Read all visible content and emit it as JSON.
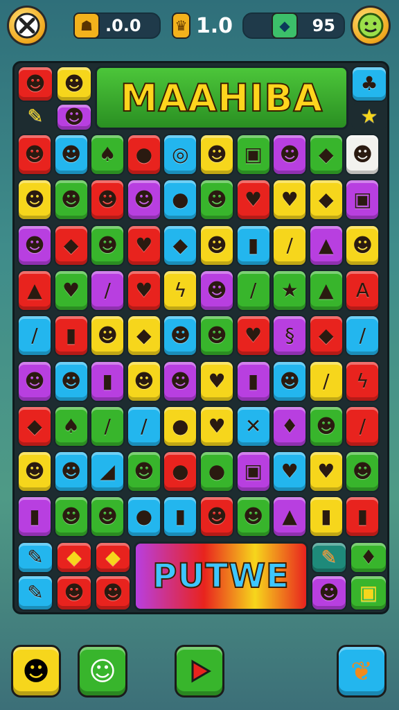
{
  "top_bar": {
    "close_icon": "close-icon",
    "coins": {
      "icon": "coin-icon",
      "value": ".0.0"
    },
    "trophy": {
      "icon": "trophy-icon",
      "value": "1.0"
    },
    "gems": {
      "icon": "gem-icon",
      "value": "95"
    },
    "profile_icon": "profile-avatar-icon"
  },
  "board": {
    "top_banner": "MAAHIBA",
    "bottom_banner": "PUTWE",
    "colors": {
      "R": "#e8231e",
      "Y": "#f6d61c",
      "G": "#38b52c",
      "B": "#23b6ee",
      "P": "#b83fe0",
      "O": "#f08a1c",
      "W": "#f2f2ee",
      "T": "#1e8a7a"
    },
    "rows": [
      [
        "R",
        "B",
        "G",
        "R",
        "B",
        "Y",
        "G",
        "P",
        "G",
        "W"
      ],
      [
        "Y",
        "G",
        "R",
        "P",
        "B",
        "G",
        "R",
        "Y",
        "Y",
        "P"
      ],
      [
        "P",
        "R",
        "G",
        "R",
        "B",
        "Y",
        "B",
        "Y",
        "P",
        "Y"
      ],
      [
        "R",
        "G",
        "P",
        "R",
        "Y",
        "P",
        "G",
        "G",
        "G",
        "R"
      ],
      [
        "B",
        "R",
        "Y",
        "Y",
        "B",
        "G",
        "R",
        "P",
        "R",
        "B"
      ],
      [
        "P",
        "B",
        "P",
        "Y",
        "P",
        "Y",
        "P",
        "B",
        "Y",
        "R"
      ],
      [
        "R",
        "G",
        "G",
        "B",
        "Y",
        "Y",
        "B",
        "P",
        "G",
        "R"
      ],
      [
        "Y",
        "B",
        "B",
        "G",
        "R",
        "G",
        "P",
        "B",
        "Y",
        "G"
      ],
      [
        "P",
        "G",
        "G",
        "B",
        "B",
        "R",
        "G",
        "P",
        "Y",
        "R"
      ]
    ],
    "glyphs": [
      [
        "☻",
        "☻",
        "♠",
        "●",
        "◎",
        "☻",
        "▣",
        "☻",
        "◆",
        "☻"
      ],
      [
        "☻",
        "☻",
        "☻",
        "☻",
        "●",
        "☻",
        "♥",
        "♥",
        "◆",
        "▣"
      ],
      [
        "☻",
        "◆",
        "☻",
        "♥",
        "◆",
        "☻",
        "▮",
        "/",
        "▲",
        "☻"
      ],
      [
        "▲",
        "♥",
        "/",
        "♥",
        "ϟ",
        "☻",
        "/",
        "★",
        "▲",
        "A"
      ],
      [
        "/",
        "▮",
        "☻",
        "◆",
        "☻",
        "☻",
        "♥",
        "§",
        "◆",
        "/"
      ],
      [
        "☻",
        "☻",
        "▮",
        "☻",
        "☻",
        "♥",
        "▮",
        "☻",
        "/",
        "ϟ"
      ],
      [
        "◆",
        "♠",
        "/",
        "/",
        "●",
        "♥",
        "✕",
        "♦",
        "☻",
        "/"
      ],
      [
        "☻",
        "☻",
        "◢",
        "☻",
        "●",
        "●",
        "▣",
        "♥",
        "♥",
        "☻"
      ],
      [
        "▮",
        "☻",
        "☻",
        "●",
        "▮",
        "☻",
        "☻",
        "▲",
        "▮",
        "▮"
      ]
    ]
  },
  "bottom_bar": {
    "buttons": [
      {
        "icon": "character-face-icon",
        "color": "#f6d61c"
      },
      {
        "icon": "robot-face-icon",
        "color": "#38b52c"
      },
      {
        "icon": "play-icon",
        "color": "#38b52c"
      },
      {
        "icon": "leaf-icon",
        "color": "#23b6ee"
      }
    ]
  }
}
